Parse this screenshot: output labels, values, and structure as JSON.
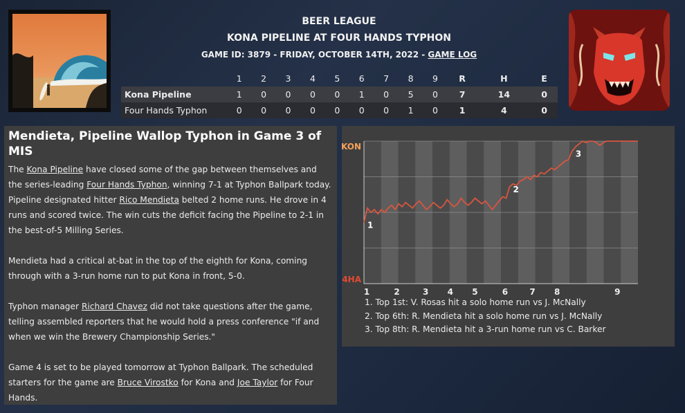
{
  "header": {
    "league": "BEER LEAGUE",
    "matchup": "KONA PIPELINE AT FOUR HANDS TYPHON",
    "game_info": "GAME ID: 3879 - FRIDAY, OCTOBER 14TH, 2022 - ",
    "game_log_link": "GAME LOG"
  },
  "logos": {
    "left": "wave-surfer-logo",
    "right": "demon-mask-logo"
  },
  "box_score": {
    "innings": [
      "1",
      "2",
      "3",
      "4",
      "5",
      "6",
      "7",
      "8",
      "9"
    ],
    "totals_headers": [
      "R",
      "H",
      "E"
    ],
    "teams": [
      {
        "name": "Kona Pipeline",
        "innings": [
          "1",
          "0",
          "0",
          "0",
          "0",
          "1",
          "0",
          "5",
          "0"
        ],
        "R": "7",
        "H": "14",
        "E": "0"
      },
      {
        "name": "Four Hands Typhon",
        "innings": [
          "0",
          "0",
          "0",
          "0",
          "0",
          "0",
          "0",
          "1",
          "0"
        ],
        "R": "1",
        "H": "4",
        "E": "0"
      }
    ]
  },
  "article": {
    "headline": "Mendieta, Pipeline Wallop Typhon in Game 3 of MIS",
    "p1": {
      "t1": "The ",
      "l1": "Kona Pipeline",
      "t2": " have closed some of the gap between themselves and the series-leading ",
      "l2": "Four Hands Typhon",
      "t3": ", winning 7-1 at Typhon Ballpark today. Pipeline designated hitter ",
      "l3": "Rico Mendieta",
      "t4": " belted 2 home runs. He drove in 4 runs and scored twice. The win cuts the deficit facing the Pipeline to 2-1 in the best-of-5 Milling Series."
    },
    "p2": "Mendieta had a critical at-bat in the top of the eighth for Kona, coming through with a 3-run home run to put Kona in front, 5-0.",
    "p3": {
      "t1": "Typhon manager ",
      "l1": "Richard Chavez",
      "t2": " did not take questions after the game, telling assembled reporters that he would hold a press conference \"if and when we win the Brewery Championship Series.\""
    },
    "p4": {
      "t1": "Game 4 is set to be played tomorrow at Typhon Ballpark. The scheduled starters for the game are ",
      "l1": "Bruce Virostko",
      "t2": " for Kona and ",
      "l2": "Joe Taylor",
      "t3": " for Four Hands."
    }
  },
  "chart_data": {
    "type": "line",
    "title": "",
    "y_top_label": "KON",
    "y_bottom_label": "4HA",
    "y_range": [
      0,
      1
    ],
    "x_tick_labels": [
      "1",
      "2",
      "3",
      "4",
      "5",
      "6",
      "7",
      "8",
      "9"
    ],
    "line_color": "#d8563f",
    "top_label_color": "#f5a05a",
    "bottom_label_color": "#e04a32",
    "series": [
      {
        "values": [
          0.43,
          0.53,
          0.5,
          0.52,
          0.49,
          0.52,
          0.5,
          0.53,
          0.55,
          0.52,
          0.56,
          0.54,
          0.57,
          0.55,
          0.53,
          0.56,
          0.58,
          0.55,
          0.52,
          0.54,
          0.57,
          0.55,
          0.53,
          0.55,
          0.59,
          0.56,
          0.54,
          0.56,
          0.6,
          0.57,
          0.55,
          0.57,
          0.6,
          0.58,
          0.56,
          0.58,
          0.55,
          0.52,
          0.55,
          0.58,
          0.61,
          0.6,
          0.68,
          0.7,
          0.69,
          0.72,
          0.73,
          0.75,
          0.73,
          0.76,
          0.75,
          0.78,
          0.77,
          0.79,
          0.81,
          0.8,
          0.82,
          0.84,
          0.86,
          0.87,
          0.93,
          0.96,
          0.98,
          1.0,
          0.99,
          1.0,
          1.0,
          0.99,
          0.97,
          0.99,
          1.0,
          1.0,
          1.0,
          1.0,
          1.0,
          1.0,
          1.0,
          1.0,
          1.0,
          1.0
        ]
      }
    ],
    "event_markers": [
      {
        "label": "1",
        "index": 0
      },
      {
        "label": "2",
        "index": 42
      },
      {
        "label": "3",
        "index": 60
      }
    ],
    "innings_band_count": 16,
    "grid": true
  },
  "events": [
    "1. Top 1st: V. Rosas hit a solo home run vs J. McNally",
    "2. Top 6th: R. Mendieta hit a solo home run vs J. McNally",
    "3. Top 8th: R. Mendieta hit a 3-run home run vs C. Barker"
  ]
}
